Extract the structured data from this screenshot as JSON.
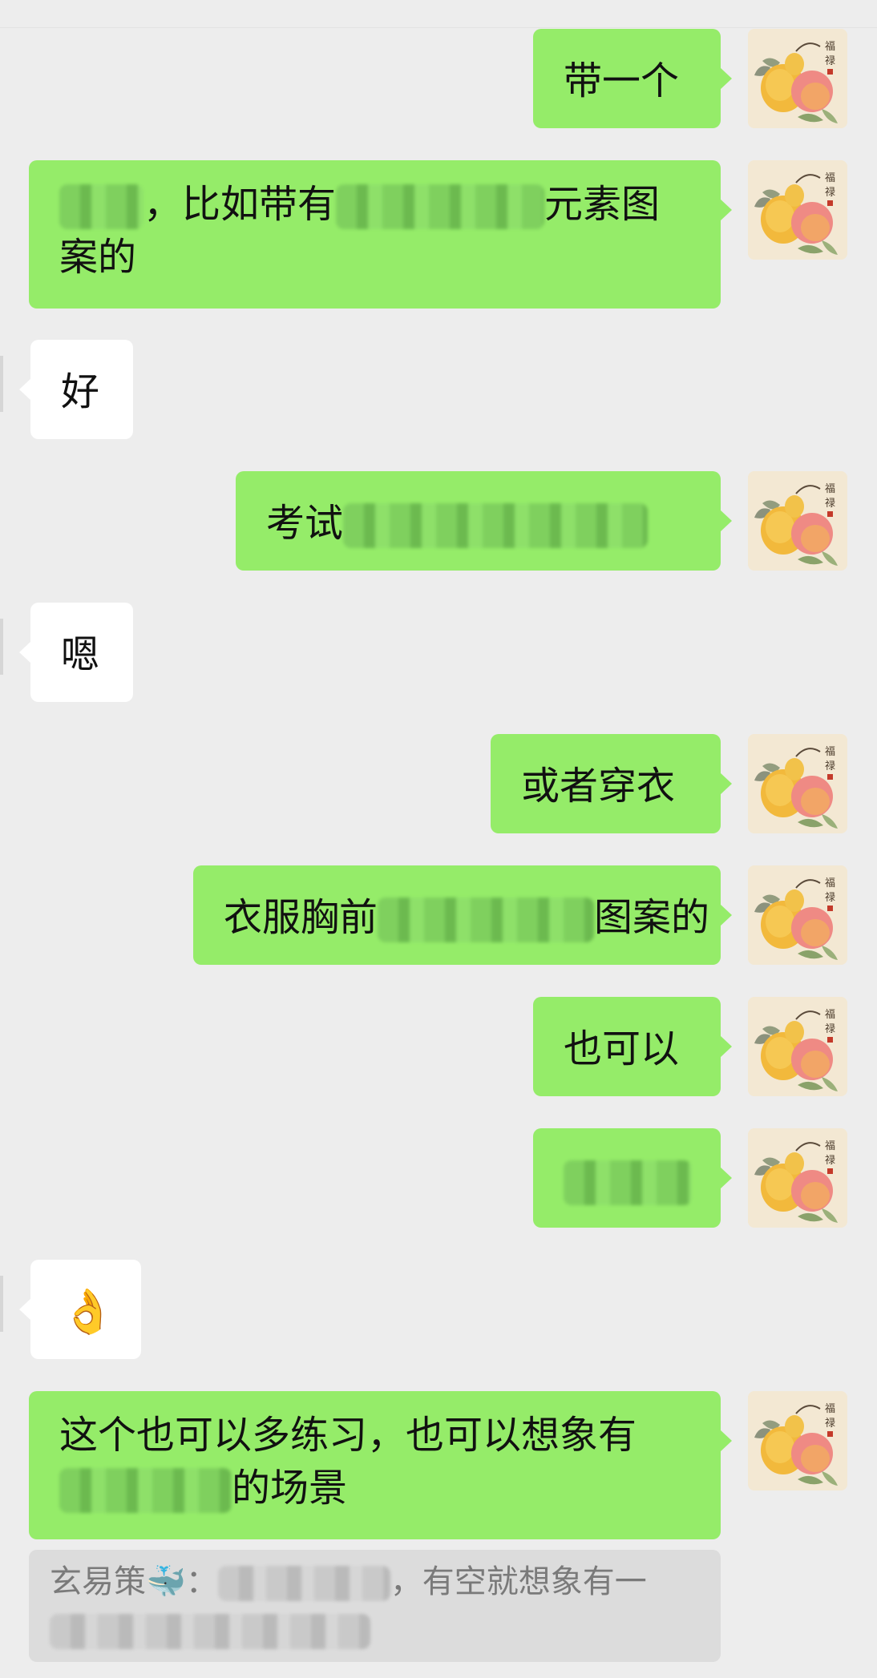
{
  "messages": [
    {
      "text": "带一个"
    },
    {
      "text_after": "，比如带有",
      "text_end": "元素图案的"
    },
    {
      "text": "好"
    },
    {
      "text": "考试"
    },
    {
      "text": "嗯"
    },
    {
      "text": "或者穿衣"
    },
    {
      "text": "衣服胸前",
      "text_end": "图案的"
    },
    {
      "text": "也可以"
    },
    {
      "text": ""
    },
    {
      "text": "👌"
    },
    {
      "text": "这个也可以多练习，也可以想象有",
      "text_end": "的场景"
    }
  ],
  "quote": {
    "sender": "玄易策🐳：",
    "text": "，有空就想象有一"
  },
  "colors": {
    "background": "#ededed",
    "my_bubble": "#95ec69",
    "their_bubble": "#ffffff",
    "quote_bg": "#dcdcdc"
  },
  "avatar": {
    "icon": "peach-gourd-painting-avatar"
  }
}
